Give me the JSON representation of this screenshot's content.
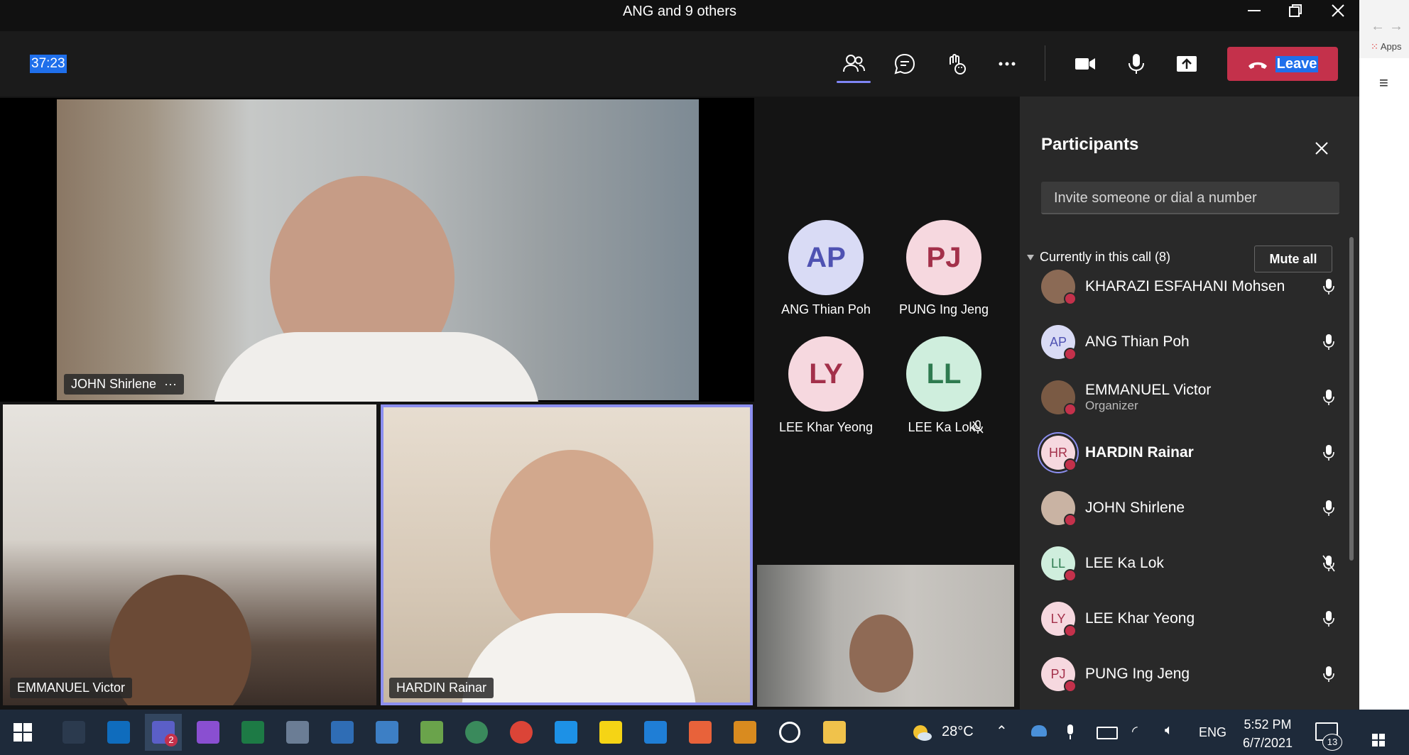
{
  "window": {
    "title": "ANG and 9 others"
  },
  "toolbar": {
    "timer": "37:23",
    "leave_label": "Leave"
  },
  "stage": {
    "tiles": [
      {
        "name": "JOHN Shirlene",
        "more": "···"
      },
      {
        "name": "EMMANUEL Victor"
      },
      {
        "name": "HARDIN Rainar"
      }
    ],
    "avatars": [
      {
        "initials": "AP",
        "name": "ANG Thian Poh"
      },
      {
        "initials": "PJ",
        "name": "PUNG Ing Jeng"
      },
      {
        "initials": "LY",
        "name": "LEE Khar Yeong"
      },
      {
        "initials": "LL",
        "name": "LEE Ka Lok"
      }
    ]
  },
  "panel": {
    "title": "Participants",
    "invite_placeholder": "Invite someone or dial a number",
    "section_label": "Currently in this call (8)",
    "mute_all": "Mute all",
    "participants": [
      {
        "initials": "",
        "name": "KHARAZI ESFAHANI Mohsen",
        "role": ""
      },
      {
        "initials": "AP",
        "name": "ANG Thian Poh",
        "role": ""
      },
      {
        "initials": "",
        "name": "EMMANUEL Victor",
        "role": "Organizer"
      },
      {
        "initials": "HR",
        "name": "HARDIN Rainar",
        "role": ""
      },
      {
        "initials": "",
        "name": "JOHN Shirlene",
        "role": ""
      },
      {
        "initials": "LL",
        "name": "LEE Ka Lok",
        "role": ""
      },
      {
        "initials": "LY",
        "name": "LEE Khar Yeong",
        "role": ""
      },
      {
        "initials": "PJ",
        "name": "PUNG Ing Jeng",
        "role": ""
      }
    ]
  },
  "browser": {
    "apps_label": "Apps"
  },
  "taskbar": {
    "weather": "28°C",
    "language": "ENG",
    "time": "5:52 PM",
    "date": "6/7/2021",
    "notifications": "13",
    "teams_badge": "2"
  },
  "colors": {
    "accent": "#7f85f5",
    "leave": "#c4314b",
    "panel": "#292929"
  }
}
